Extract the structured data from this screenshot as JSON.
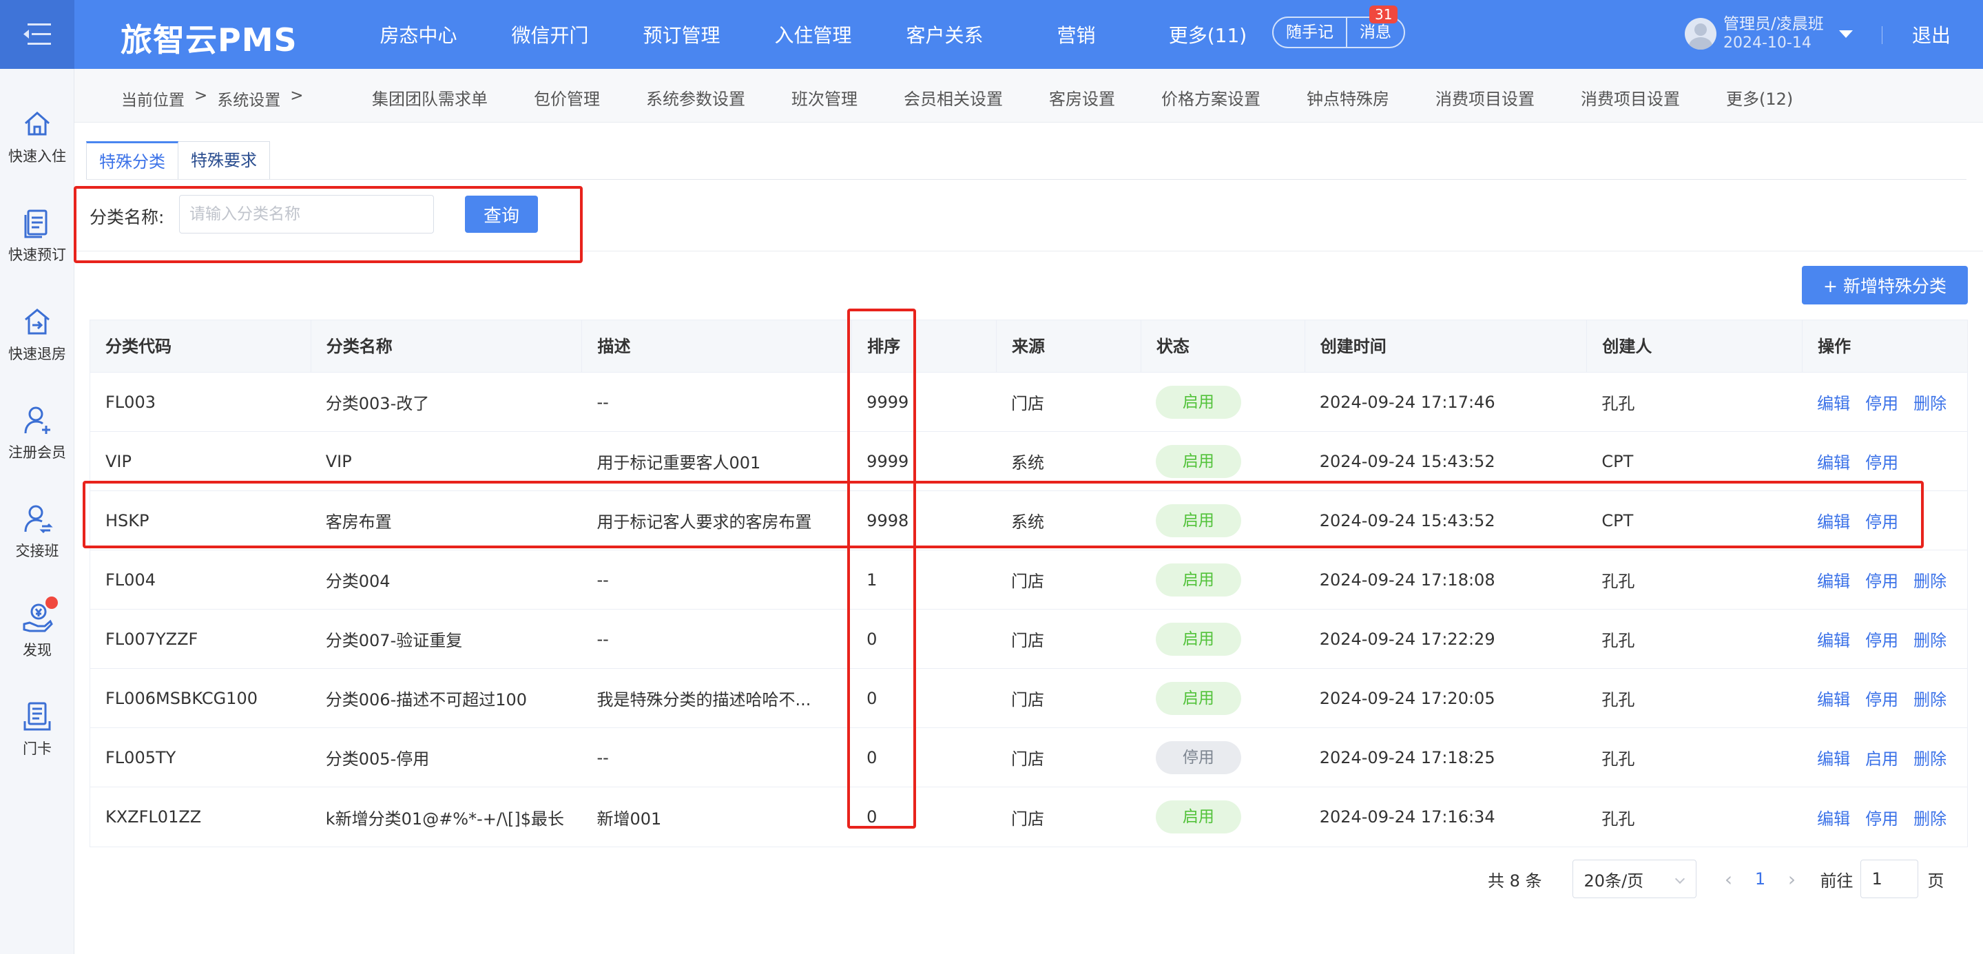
{
  "app": {
    "brand": "旅智云PMS",
    "nav": [
      "房态中心",
      "微信开门",
      "预订管理",
      "入住管理",
      "客户关系",
      "营销",
      "更多(11)"
    ],
    "notes_label": "随手记",
    "messages_label": "消息",
    "messages_badge": "31",
    "user_name": "管理员/凌晨班",
    "user_date": "2024-10-14",
    "logout": "退出"
  },
  "sidebar": [
    {
      "label": "快速入住",
      "icon": "home-icon"
    },
    {
      "label": "快速预订",
      "icon": "document-icon"
    },
    {
      "label": "快速退房",
      "icon": "checkout-icon"
    },
    {
      "label": "注册会员",
      "icon": "user-add-icon"
    },
    {
      "label": "交接班",
      "icon": "user-swap-icon"
    },
    {
      "label": "发现",
      "icon": "discover-icon"
    },
    {
      "label": "门卡",
      "icon": "card-icon"
    }
  ],
  "breadcrumb": {
    "current": "当前位置",
    "sep1": ">",
    "section": "系统设置",
    "sep2": ">"
  },
  "sub_nav": [
    "集团团队需求单",
    "包价管理",
    "系统参数设置",
    "班次管理",
    "会员相关设置",
    "客房设置",
    "价格方案设置",
    "钟点特殊房",
    "消费项目设置",
    "消费项目设置",
    "更多(12)"
  ],
  "tabs": [
    "特殊分类",
    "特殊要求"
  ],
  "filter": {
    "label": "分类名称:",
    "placeholder": "请输入分类名称",
    "query_button": "查询"
  },
  "add_button": "+ 新增特殊分类",
  "table": {
    "headers": [
      "分类代码",
      "分类名称",
      "描述",
      "排序",
      "来源",
      "状态",
      "创建时间",
      "创建人",
      "操作"
    ],
    "rows": [
      {
        "code": "FL003",
        "name": "分类003-改了",
        "desc": "--",
        "sort": "9999",
        "source": "门店",
        "status": "启用",
        "status_on": true,
        "created": "2024-09-24 17:17:46",
        "creator": "孔孔",
        "ops": [
          "编辑",
          "停用",
          "删除"
        ]
      },
      {
        "code": "VIP",
        "name": "VIP",
        "desc": "用于标记重要客人001",
        "sort": "9999",
        "source": "系统",
        "status": "启用",
        "status_on": true,
        "created": "2024-09-24 15:43:52",
        "creator": "CPT",
        "ops": [
          "编辑",
          "停用"
        ]
      },
      {
        "code": "HSKP",
        "name": "客房布置",
        "desc": "用于标记客人要求的客房布置",
        "sort": "9998",
        "source": "系统",
        "status": "启用",
        "status_on": true,
        "created": "2024-09-24 15:43:52",
        "creator": "CPT",
        "ops": [
          "编辑",
          "停用"
        ]
      },
      {
        "code": "FL004",
        "name": "分类004",
        "desc": "--",
        "sort": "1",
        "source": "门店",
        "status": "启用",
        "status_on": true,
        "created": "2024-09-24 17:18:08",
        "creator": "孔孔",
        "ops": [
          "编辑",
          "停用",
          "删除"
        ]
      },
      {
        "code": "FL007YZZF",
        "name": "分类007-验证重复",
        "desc": "--",
        "sort": "0",
        "source": "门店",
        "status": "启用",
        "status_on": true,
        "created": "2024-09-24 17:22:29",
        "creator": "孔孔",
        "ops": [
          "编辑",
          "停用",
          "删除"
        ]
      },
      {
        "code": "FL006MSBKCG100",
        "name": "分类006-描述不可超过100",
        "desc": "我是特殊分类的描述哈哈不...",
        "sort": "0",
        "source": "门店",
        "status": "启用",
        "status_on": true,
        "created": "2024-09-24 17:20:05",
        "creator": "孔孔",
        "ops": [
          "编辑",
          "停用",
          "删除"
        ]
      },
      {
        "code": "FL005TY",
        "name": "分类005-停用",
        "desc": "--",
        "sort": "0",
        "source": "门店",
        "status": "停用",
        "status_on": false,
        "created": "2024-09-24 17:18:25",
        "creator": "孔孔",
        "ops": [
          "编辑",
          "启用",
          "删除"
        ]
      },
      {
        "code": "KXZFL01ZZ",
        "name": "k新增分类01@#%*-+/\\[]$最长",
        "desc": "新增001",
        "sort": "0",
        "source": "门店",
        "status": "启用",
        "status_on": true,
        "created": "2024-09-24 17:16:34",
        "creator": "孔孔",
        "ops": [
          "编辑",
          "停用",
          "删除"
        ]
      }
    ]
  },
  "pagination": {
    "total": "共 8 条",
    "page_size": "20条/页",
    "current_page": "1",
    "goto_label": "前往",
    "goto_value": "1",
    "goto_suffix": "页"
  },
  "colors": {
    "primary": "#4a86f0",
    "highlight": "#e8231c",
    "status_on_bg": "#e5f6e1",
    "status_on_text": "#52c23a"
  }
}
